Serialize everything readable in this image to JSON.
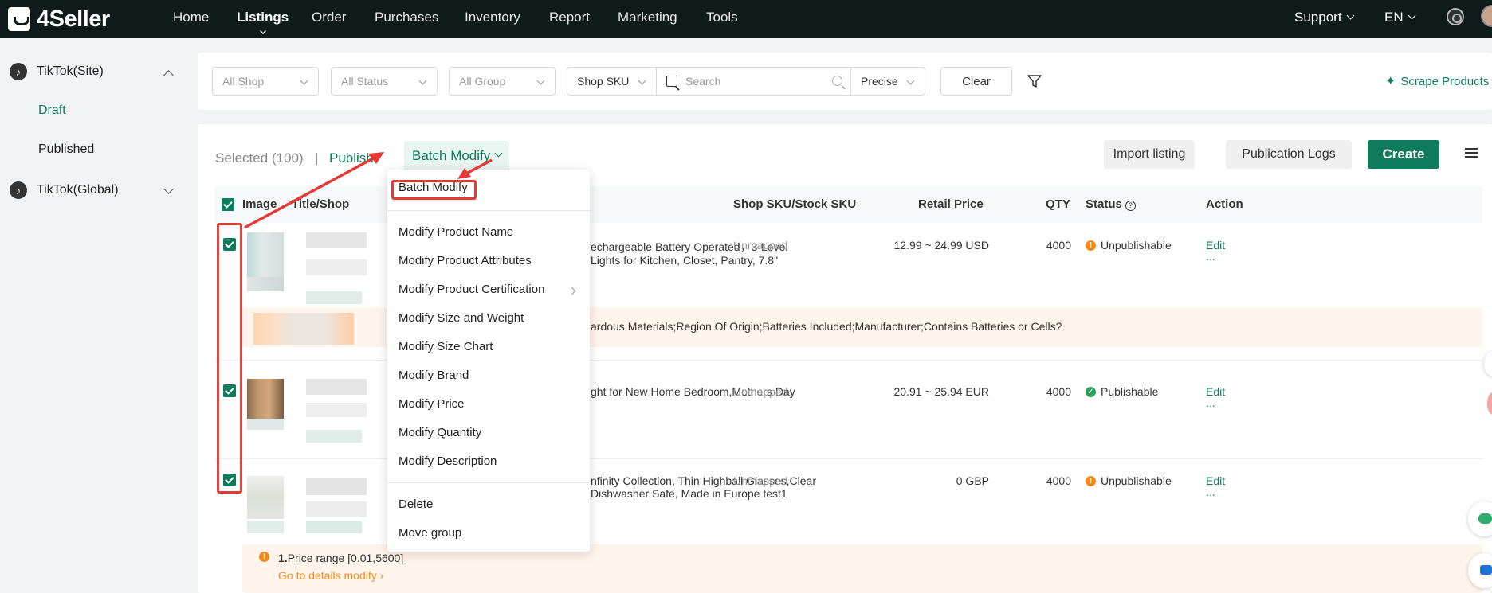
{
  "brand": "4Seller",
  "nav": {
    "items": [
      "Home",
      "Listings",
      "Order",
      "Purchases",
      "Inventory",
      "Report",
      "Marketing",
      "Tools"
    ],
    "support": "Support",
    "lang": "EN"
  },
  "sidebar": {
    "group1": "TikTok(Site)",
    "draft": "Draft",
    "published": "Published",
    "group2": "TikTok(Global)"
  },
  "filters": {
    "shop": "All Shop",
    "status": "All Status",
    "group": "All Group",
    "sku_field": "Shop SKU",
    "search_placeholder": "Search",
    "match": "Precise",
    "clear": "Clear",
    "scrape": "Scrape Products"
  },
  "toolbar": {
    "selected": "Selected (100)",
    "separator": "|",
    "publish": "Publish",
    "batch_modify": "Batch Modify",
    "import": "Import listing",
    "logs": "Publication Logs",
    "create": "Create"
  },
  "table": {
    "headers": {
      "image": "Image",
      "title": "Title/Shop",
      "sku": "Shop SKU/Stock SKU",
      "price": "Retail Price",
      "qty": "QTY",
      "status": "Status",
      "action": "Action"
    },
    "rows": [
      {
        "title_line1": "echargeable Battery Operated，3-Level",
        "title_line2": "Lights for Kitchen, Closet, Pantry, 7.8\"",
        "sku": "Unmapped",
        "price": "12.99 ~ 24.99 USD",
        "qty": "4000",
        "status": "Unpublishable",
        "edit": "Edit",
        "more": "...",
        "warning": "ardous Materials;Region Of Origin;Batteries Included;Manufacturer;Contains Batteries or Cells?"
      },
      {
        "title_line1": "ght for New Home Bedroom,Mothers Day",
        "sku": "Unmapped",
        "price": "20.91 ~ 25.94 EUR",
        "qty": "4000",
        "status": "Publishable",
        "edit": "Edit",
        "more": "..."
      },
      {
        "title_line1": "nfinity Collection, Thin Highball Glasses,Clear",
        "title_line2": "Dishwasher Safe, Made in Europe test1",
        "sku": "Unmapped",
        "price": "0 GBP",
        "qty": "4000",
        "status": "Unpublishable",
        "edit": "Edit",
        "more": "...",
        "warning_num": "1.",
        "warning": "Price range [0.01,5600]",
        "warning_link": "Go to details modify"
      }
    ]
  },
  "dropdown": {
    "header": "Batch Modify",
    "items": [
      "Modify Product Name",
      "Modify Product Attributes",
      "Modify Product Certification",
      "Modify Size and Weight",
      "Modify Size Chart",
      "Modify Brand",
      "Modify Price",
      "Modify Quantity",
      "Modify Description"
    ],
    "delete": "Delete",
    "move": "Move group"
  },
  "colors": {
    "accent": "#0e7c5c",
    "nav_bg": "#0f1a1a",
    "annotation": "#e23b36",
    "warning": "#f28b16"
  }
}
